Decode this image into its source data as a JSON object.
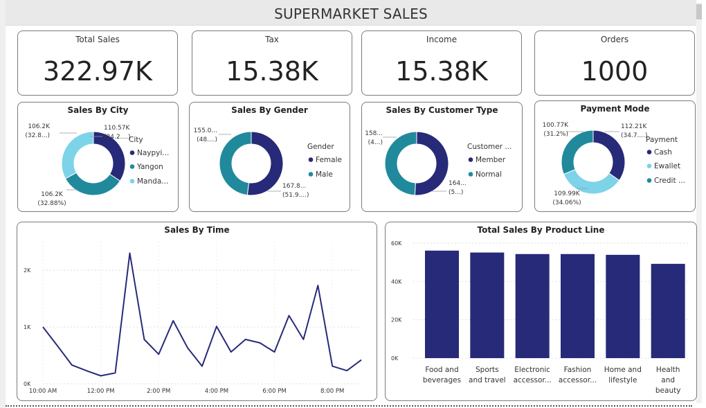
{
  "header": {
    "title": "SUPERMARKET SALES"
  },
  "kpis": [
    {
      "label": "Total Sales",
      "value": "322.97K"
    },
    {
      "label": "Tax",
      "value": "15.38K"
    },
    {
      "label": "Income",
      "value": "15.38K"
    },
    {
      "label": "Orders",
      "value": "1000"
    }
  ],
  "colors": {
    "navy": "#262a78",
    "teal": "#208a9c",
    "light": "#7dd3e8",
    "grid": "#dddddd"
  },
  "chart_data": [
    {
      "type": "pie",
      "title": "Sales By City",
      "legend_title": "City",
      "slices": [
        {
          "name": "Naypyi...",
          "value": 110.57,
          "label": "110.57K",
          "pct": "(34.2....)"
        },
        {
          "name": "Yangon",
          "value": 106.2,
          "label": "106.2K",
          "pct": "(32.88%)"
        },
        {
          "name": "Manda...",
          "value": 106.2,
          "label": "106.2K",
          "pct": "(32.8...)"
        }
      ]
    },
    {
      "type": "pie",
      "title": "Sales By Gender",
      "legend_title": "Gender",
      "slices": [
        {
          "name": "Female",
          "value": 167.8,
          "label": "167.8...",
          "pct": "(51.9....)"
        },
        {
          "name": "Male",
          "value": 155.0,
          "label": "155.0...",
          "pct": "(48....)"
        }
      ]
    },
    {
      "type": "pie",
      "title": "Sales By Customer Type",
      "legend_title": "Customer ...",
      "slices": [
        {
          "name": "Member",
          "value": 164,
          "label": "164...",
          "pct": "(5...)"
        },
        {
          "name": "Normal",
          "value": 158,
          "label": "158...",
          "pct": "(4...)"
        }
      ]
    },
    {
      "type": "pie",
      "title": "Payment Mode",
      "legend_title": "Payment",
      "slices": [
        {
          "name": "Cash",
          "value": 112.21,
          "label": "112.21K",
          "pct": "(34.7....)"
        },
        {
          "name": "Ewallet",
          "value": 109.99,
          "label": "109.99K",
          "pct": "(34.06%)"
        },
        {
          "name": "Credit ...",
          "value": 100.77,
          "label": "100.77K",
          "pct": "(31.2%)"
        }
      ]
    },
    {
      "type": "line",
      "title": "Sales By Time",
      "x": [
        10.0,
        10.5,
        11.0,
        11.5,
        12.0,
        12.5,
        13.0,
        13.5,
        14.0,
        14.5,
        15.0,
        15.5,
        16.0,
        16.5,
        17.0,
        17.5,
        18.0,
        18.5,
        19.0,
        19.5,
        20.0,
        20.5,
        21.0
      ],
      "y": [
        1000,
        670,
        330,
        230,
        140,
        190,
        2300,
        780,
        520,
        1110,
        630,
        310,
        1010,
        560,
        780,
        720,
        560,
        1200,
        780,
        1730,
        310,
        230,
        420
      ],
      "xticks": [
        {
          "v": 10,
          "label": "10:00 AM"
        },
        {
          "v": 12,
          "label": "12:00 PM"
        },
        {
          "v": 14,
          "label": "2:00 PM"
        },
        {
          "v": 16,
          "label": "4:00 PM"
        },
        {
          "v": 18,
          "label": "6:00 PM"
        },
        {
          "v": 20,
          "label": "8:00 PM"
        }
      ],
      "yticks": [
        {
          "v": 0,
          "label": "0K"
        },
        {
          "v": 1000,
          "label": "1K"
        },
        {
          "v": 2000,
          "label": "2K"
        }
      ],
      "xlim": [
        10,
        21
      ],
      "ylim": [
        0,
        2500
      ]
    },
    {
      "type": "bar",
      "title": "Total Sales By Product Line",
      "categories": [
        [
          "Food and",
          "beverages"
        ],
        [
          "Sports",
          "and travel"
        ],
        [
          "Electronic",
          "accessor..."
        ],
        [
          "Fashion",
          "accessor..."
        ],
        [
          "Home and",
          "lifestyle"
        ],
        [
          "Health",
          "and",
          "beauty"
        ]
      ],
      "values": [
        56100,
        55100,
        54300,
        54300,
        53900,
        49200
      ],
      "yticks": [
        {
          "v": 0,
          "label": "0K"
        },
        {
          "v": 20000,
          "label": "20K"
        },
        {
          "v": 40000,
          "label": "40K"
        },
        {
          "v": 60000,
          "label": "60K"
        }
      ],
      "ylim": [
        0,
        60000
      ]
    }
  ]
}
